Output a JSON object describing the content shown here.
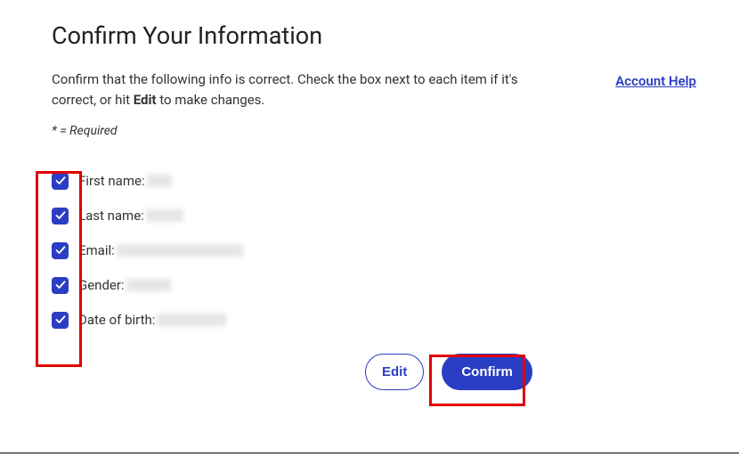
{
  "page_title": "Confirm Your Information",
  "instruction_pre": "Confirm that the following info is correct. Check the box next to each item if it's correct, or hit ",
  "instruction_bold": "Edit",
  "instruction_post": " to make changes.",
  "legend": "* = Required",
  "account_help_label": "Account Help",
  "fields": [
    {
      "label": "First name:",
      "checked": true,
      "redacted_width": "w30"
    },
    {
      "label": "Last name:",
      "checked": true,
      "redacted_width": "w45"
    },
    {
      "label": "Email:",
      "checked": true,
      "redacted_width": "w120"
    },
    {
      "label": "Gender:",
      "checked": true,
      "redacted_width": "w55"
    },
    {
      "label": "Date of birth:",
      "checked": true,
      "redacted_width": "w80"
    }
  ],
  "buttons": {
    "edit": "Edit",
    "confirm": "Confirm"
  },
  "colors": {
    "primary": "#2a3ec4",
    "annotation": "#e00000"
  }
}
